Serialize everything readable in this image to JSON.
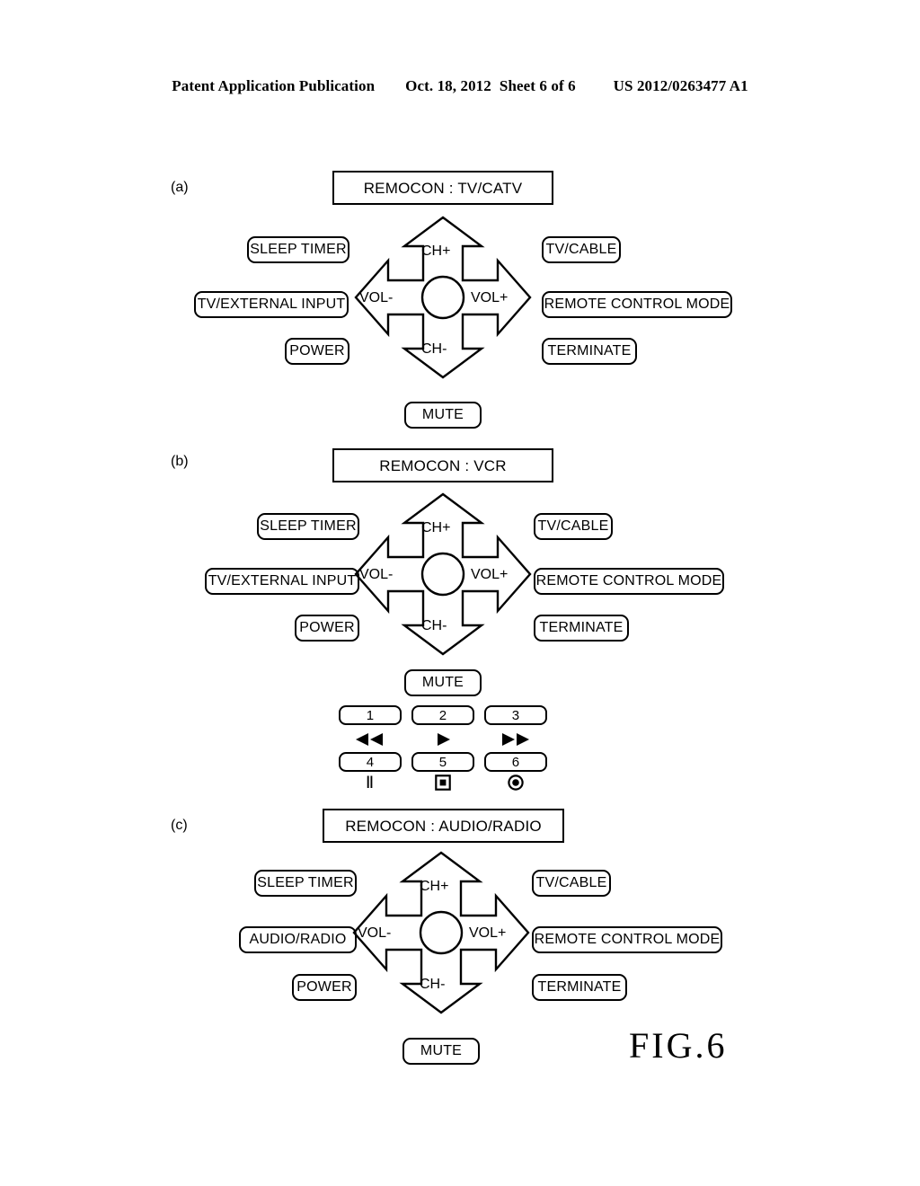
{
  "header": {
    "publication": "Patent Application Publication",
    "date": "Oct. 18, 2012",
    "sheet": "Sheet 6 of 6",
    "number": "US 2012/0263477 A1"
  },
  "figure_label": "FIG.6",
  "dpad": {
    "up_label": "CH+",
    "down_label": "CH-",
    "left_label": "VOL-",
    "right_label": "VOL+"
  },
  "panels": [
    {
      "letter": "(a)",
      "title": "REMOCON : TV/CATV",
      "left_labels": [
        "SLEEP TIMER",
        "TV/EXTERNAL INPUT",
        "POWER"
      ],
      "right_labels": [
        "TV/CABLE",
        "REMOTE CONTROL MODE",
        "TERMINATE"
      ],
      "bottom_label": "MUTE"
    },
    {
      "letter": "(b)",
      "title": "REMOCON : VCR",
      "left_labels": [
        "SLEEP TIMER",
        "TV/EXTERNAL INPUT",
        "POWER"
      ],
      "right_labels": [
        "TV/CABLE",
        "REMOTE CONTROL MODE",
        "TERMINATE"
      ],
      "bottom_label": "MUTE",
      "transport": {
        "row1": [
          {
            "number": "1",
            "icon": "rewind-icon"
          },
          {
            "number": "2",
            "icon": "play-icon"
          },
          {
            "number": "3",
            "icon": "fast-forward-icon"
          }
        ],
        "row2": [
          {
            "number": "4",
            "icon": "pause-icon",
            "glyph": "Ⅱ"
          },
          {
            "number": "5",
            "icon": "stop-icon"
          },
          {
            "number": "6",
            "icon": "record-icon"
          }
        ]
      }
    },
    {
      "letter": "(c)",
      "title": "REMOCON : AUDIO/RADIO",
      "left_labels": [
        "SLEEP TIMER",
        "AUDIO/RADIO",
        "POWER"
      ],
      "right_labels": [
        "TV/CABLE",
        "REMOTE CONTROL MODE",
        "TERMINATE"
      ],
      "bottom_label": "MUTE"
    }
  ]
}
